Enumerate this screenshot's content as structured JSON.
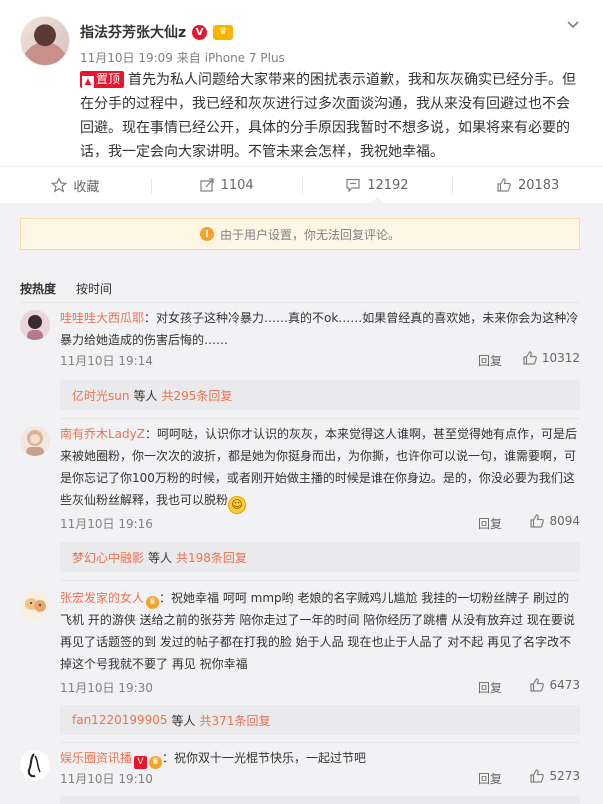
{
  "post": {
    "author": "指法芬芳张大仙z",
    "time": "11月10日 19:09",
    "from_label": "来自",
    "device": "iPhone 7 Plus",
    "pin_label": "置顶",
    "text": "首先为私人问题给大家带来的困扰表示道歉，我和灰灰确实已经分手。但在分手的过程中，我已经和灰灰进行过多次面谈沟通，我从来没有回避过也不会回避。现在事情已经公开，具体的分手原因我暂时不想多说，如果将来有必要的话，我一定会向大家讲明。不管未来会怎样，我祝她幸福。"
  },
  "actions": {
    "favorite_label": "收藏",
    "repost_count": "1104",
    "comment_count": "12192",
    "like_count": "20183"
  },
  "comments_section": {
    "notice": "由于用户设置，你无法回复评论。",
    "sort_hot": "按热度",
    "sort_time": "按时间",
    "reply_label": "回复",
    "items": [
      {
        "user": "哇哇哇大西瓜耶",
        "text": "：对女孩子这种冷暴力……真的不ok……如果曾经真的喜欢她，未来你会为这种冷暴力给她造成的伤害后悔的……",
        "time": "11月10日 19:14",
        "likes": "10312",
        "sub_user": "亿时光sun",
        "sub_mid": "等人",
        "sub_more": "共295条回复"
      },
      {
        "user": "南有乔木LadyZ",
        "text": "：呵呵哒，认识你才认识的灰灰，本来觉得这人谁啊，甚至觉得她有点作，可是后来被她圈粉，你一次次的波折，都是她为你挺身而出，为你撕，也许你可以说一句，谁需要啊，可是你忘记了你100万粉的时候，或者刚开始做主播的时候是谁在你身边。是的，你没必要为我们这些灰仙粉丝解释，我也可以脱粉",
        "time": "11月10日 19:16",
        "likes": "8094",
        "sub_user": "梦幻心中融影",
        "sub_mid": "等人",
        "sub_more": "共198条回复"
      },
      {
        "user": "张宏发家的女人",
        "text": "：祝她幸福 呵呵 mmp哟 老娘的名字贼鸡儿尴尬 我挂的一切粉丝牌子 刷过的飞机 开的游侠 送给之前的张芬芳 陪你走过了一年的时间 陪你经历了跳槽 从没有放弃过 现在要说再见了话题签的到 发过的帖子都在打我的脸 始于人品 现在也止于人品了 对不起 再见了名字改不掉这个号我就不要了 再见 祝你幸福",
        "time": "11月10日 19:30",
        "likes": "6473",
        "sub_user": "fan1220199905",
        "sub_mid": "等人",
        "sub_more": "共371条回复"
      },
      {
        "user": "娱乐圈资讯播",
        "text": "：祝你双十一光棍节快乐，一起过节吧",
        "time": "11月10日 19:10",
        "likes": "5273"
      }
    ]
  }
}
